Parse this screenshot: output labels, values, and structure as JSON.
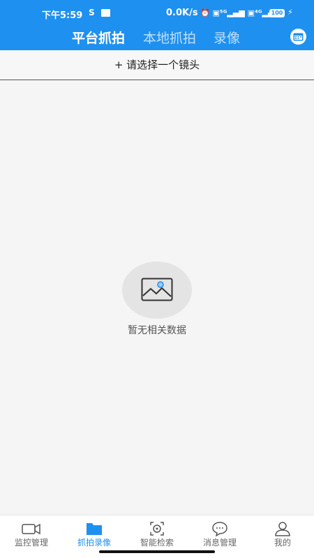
{
  "status_bar": {
    "time": "下午5:59",
    "speed": "0.0K/s",
    "battery": "100"
  },
  "header": {
    "tabs": [
      {
        "label": "平台抓拍",
        "active": true
      },
      {
        "label": "本地抓拍",
        "active": false
      },
      {
        "label": "录像",
        "active": false
      }
    ],
    "calendar_icon": "calendar-icon"
  },
  "lens_selector": {
    "label": "+ 请选择一个镜头"
  },
  "empty_state": {
    "icon": "image-placeholder-icon",
    "text": "暂无相关数据"
  },
  "bottom_nav": {
    "items": [
      {
        "label": "监控管理",
        "icon": "video-camera-icon",
        "active": false
      },
      {
        "label": "抓拍录像",
        "icon": "folder-icon",
        "active": true
      },
      {
        "label": "智能检索",
        "icon": "smart-search-icon",
        "active": false
      },
      {
        "label": "消息管理",
        "icon": "chat-bubble-icon",
        "active": false
      },
      {
        "label": "我的",
        "icon": "user-icon",
        "active": false
      }
    ]
  },
  "colors": {
    "primary": "#1e90f0",
    "background": "#f5f5f5",
    "inactive_text": "#666666"
  }
}
